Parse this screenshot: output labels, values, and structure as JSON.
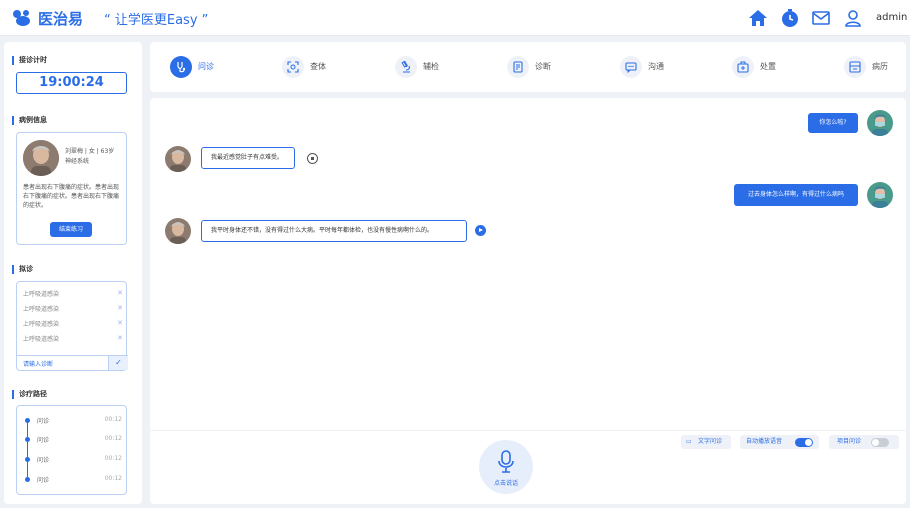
{
  "header": {
    "logo_text": "医治易",
    "slogan": "“ 让学医更Easy ”",
    "user": "admin"
  },
  "sidebar": {
    "timer_title": "接诊计时",
    "timer_value": "19:00:24",
    "case_title": "病例信息",
    "patient_info": "刘翠梅 | 女 | 63岁",
    "patient_dept": "神经系统",
    "patient_desc": "患者出现右下腹痛的症状。患者出现右下腹痛的症状。患者出现右下腹痛的症状。",
    "end_button": "结束练习",
    "diagnosis_title": "拟诊",
    "diagnosis_items": [
      "上呼吸道感染",
      "上呼吸道感染",
      "上呼吸道感染",
      "上呼吸道感染"
    ],
    "diagnosis_placeholder": "请输入诊断",
    "path_title": "诊疗路径",
    "path_items": [
      {
        "label": "问诊",
        "time": "00:12"
      },
      {
        "label": "问诊",
        "time": "00:12"
      },
      {
        "label": "问诊",
        "time": "00:12"
      },
      {
        "label": "问诊",
        "time": "00:12"
      }
    ]
  },
  "tabs": [
    {
      "label": "问诊",
      "icon": "stethoscope-icon",
      "active": true
    },
    {
      "label": "查体",
      "icon": "scan-icon"
    },
    {
      "label": "辅检",
      "icon": "microscope-icon"
    },
    {
      "label": "诊断",
      "icon": "document-icon"
    },
    {
      "label": "沟通",
      "icon": "chat-icon"
    },
    {
      "label": "处置",
      "icon": "medkit-icon"
    },
    {
      "label": "病历",
      "icon": "record-icon"
    }
  ],
  "chat": {
    "messages": [
      {
        "from": "doctor",
        "text": "你怎么啦?"
      },
      {
        "from": "patient",
        "text": "我最近感觉肚子有点难受。"
      },
      {
        "from": "doctor",
        "text": "过去身体怎么样啊，有得过什么病吗"
      },
      {
        "from": "patient",
        "text": "我平时身体还不错，没有得过什么大病。平时每年都体检，也没有慢性病啊什么的。"
      }
    ],
    "text_consult": "文字问诊",
    "auto_play": "自动播放语音",
    "project_consult": "项目问诊",
    "mic_label": "点击说话"
  },
  "colors": {
    "primary": "#2b6de6"
  }
}
